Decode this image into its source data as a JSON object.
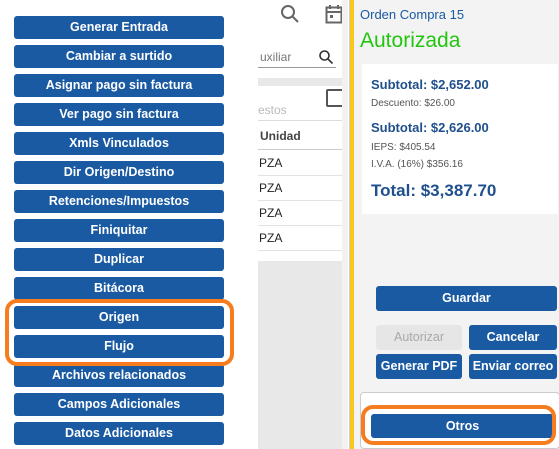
{
  "menu": {
    "items": [
      {
        "label": "Generar Entrada"
      },
      {
        "label": "Cambiar a surtido"
      },
      {
        "label": "Asignar pago sin factura"
      },
      {
        "label": "Ver pago sin factura"
      },
      {
        "label": "Xmls Vinculados"
      },
      {
        "label": "Dir Origen/Destino"
      },
      {
        "label": "Retenciones/Impuestos"
      },
      {
        "label": "Finiquitar"
      },
      {
        "label": "Duplicar"
      },
      {
        "label": "Bitácora"
      },
      {
        "label": "Origen"
      },
      {
        "label": "Flujo"
      },
      {
        "label": "Archivos relacionados"
      },
      {
        "label": "Campos Adicionales"
      },
      {
        "label": "Datos Adicionales"
      }
    ]
  },
  "table": {
    "auxiliar_text": "uxiliar",
    "faded_column": "estos",
    "header_unidad": "Unidad",
    "rows": [
      {
        "unidad": "PZA"
      },
      {
        "unidad": "PZA"
      },
      {
        "unidad": "PZA"
      },
      {
        "unidad": "PZA"
      }
    ]
  },
  "summary": {
    "order_title": "Orden Compra 15",
    "status": "Autorizada",
    "subtotal_1": "Subtotal: $2,652.00",
    "descuento": "Descuento: $26.00",
    "subtotal_2": "Subtotal: $2,626.00",
    "ieps": "IEPS: $405.54",
    "iva": "I.V.A. (16%) $356.16",
    "total": "Total: $3,387.70"
  },
  "actions": {
    "guardar": "Guardar",
    "autorizar": "Autorizar",
    "cancelar": "Cancelar",
    "generar_pdf": "Generar PDF",
    "enviar_correo": "Enviar correo",
    "otros": "Otros"
  },
  "colors": {
    "button_blue": "#1a5aa3",
    "highlight_orange": "#f57c1f",
    "status_green": "#22c50f",
    "accent_yellow": "#f8c81e"
  },
  "icons": [
    "search-icon",
    "calendar-icon",
    "checkbox"
  ]
}
